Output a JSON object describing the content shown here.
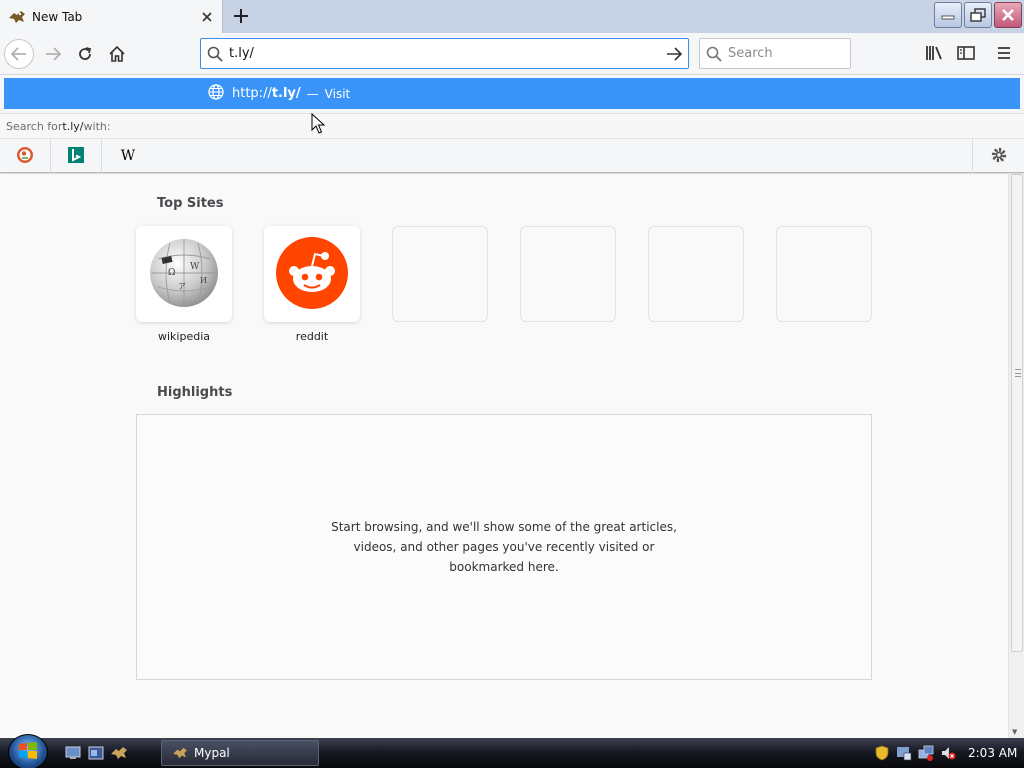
{
  "tab": {
    "title": "New Tab"
  },
  "urlbar": {
    "value": "t.ly/"
  },
  "searchbar": {
    "placeholder": "Search"
  },
  "dropdown": {
    "suggestion_prefix": "http://",
    "suggestion_host": "t.ly/",
    "suggestion_sep": "—",
    "suggestion_action": "Visit",
    "search_with_prefix": "Search for ",
    "search_with_term": "t.ly/",
    "search_with_suffix": " with:",
    "engines": [
      "duckduckgo-icon",
      "bing-icon",
      "wikipedia-icon"
    ]
  },
  "top_sites": {
    "title": "Top Sites",
    "tiles": [
      {
        "label": "wikipedia",
        "icon": "wikipedia-globe-icon"
      },
      {
        "label": "reddit",
        "icon": "reddit-icon"
      },
      {
        "label": ""
      },
      {
        "label": ""
      },
      {
        "label": ""
      },
      {
        "label": ""
      }
    ]
  },
  "highlights": {
    "title": "Highlights",
    "message": "Start browsing, and we'll show some of the great articles, videos, and other pages you've recently visited or bookmarked here."
  },
  "taskbar": {
    "app_label": "Mypal",
    "clock": "2:03 AM"
  },
  "colors": {
    "accent": "#3a94f7",
    "reddit": "#ff4500",
    "bing": "#008373",
    "duckduckgo": "#de5833"
  }
}
